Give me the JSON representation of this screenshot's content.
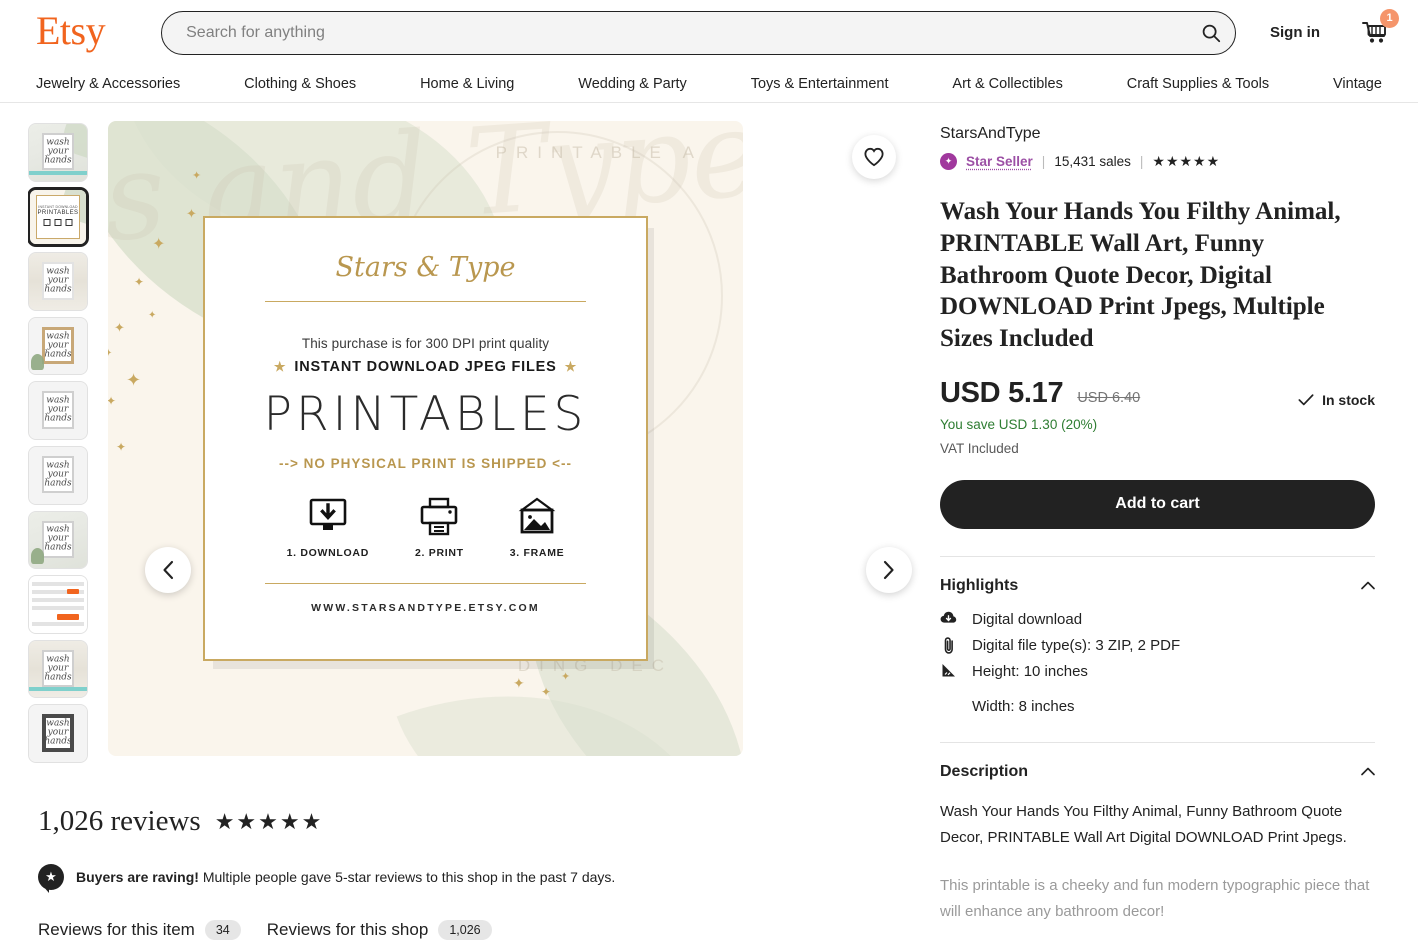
{
  "header": {
    "logo": "Etsy",
    "search_placeholder": "Search for anything",
    "search_value": "",
    "search_icon": "search-icon",
    "signin": "Sign in",
    "cart_icon": "cart-icon",
    "cart_count": "1"
  },
  "nav": {
    "items": [
      "Jewelry & Accessories",
      "Clothing & Shoes",
      "Home & Living",
      "Wedding & Party",
      "Toys & Entertainment",
      "Art & Collectibles",
      "Craft Supplies & Tools",
      "Vintage"
    ]
  },
  "gallery": {
    "favorite_icon": "heart-icon",
    "prev_label": "‹",
    "next_label": "›",
    "selected_index": 1,
    "thumbnails": [
      {
        "name": "thumb-wash-your-hands-shelf",
        "style": "wall"
      },
      {
        "name": "thumb-printables-info",
        "style": "printables"
      },
      {
        "name": "thumb-wash-your-hands-wood",
        "style": "wood"
      },
      {
        "name": "thumb-wash-your-hands-framed-wood",
        "style": "woodframe"
      },
      {
        "name": "thumb-wash-your-hands-white",
        "style": "white"
      },
      {
        "name": "thumb-wash-your-hands-plain",
        "style": "plain"
      },
      {
        "name": "thumb-wash-your-hands-plant",
        "style": "plant"
      },
      {
        "name": "thumb-how-to-download-screenshot",
        "style": "screenshot"
      },
      {
        "name": "thumb-wash-your-hands-teal",
        "style": "teal"
      },
      {
        "name": "thumb-wash-your-hands-dark-frame",
        "style": "darkframe"
      }
    ]
  },
  "hero_card": {
    "brand": "Stars & Type",
    "dpi_line": "This purchase is for 300 DPI print quality",
    "instant_line": "INSTANT DOWNLOAD JPEG FILES",
    "instant_star": "★",
    "printables": "PRINTABLES",
    "no_physical": "--> NO PHYSICAL PRINT IS SHIPPED <--",
    "steps": [
      {
        "icon": "download-monitor-icon",
        "label": "1. DOWNLOAD"
      },
      {
        "icon": "printer-icon",
        "label": "2. PRINT"
      },
      {
        "icon": "framed-picture-icon",
        "label": "3. FRAME"
      }
    ],
    "url": "WWW.STARSANDTYPE.ETSY.COM",
    "watermark": "Stars and Type",
    "watermark_arc_top": "PRINTABLE A",
    "watermark_arc_bottom": "DING DEC"
  },
  "product": {
    "shop": "StarsAndType",
    "star_seller": "Star Seller",
    "sales": "15,431 sales",
    "rating_stars": "★★★★★",
    "title": "Wash Your Hands You Filthy Animal, PRINTABLE Wall Art, Funny Bathroom Quote Decor, Digital DOWNLOAD Print Jpegs, Multiple Sizes Included",
    "price": "USD 5.17",
    "price_old": "USD 6.40",
    "you_save": "You save USD 1.30 (20%)",
    "vat": "VAT Included",
    "in_stock": "In stock",
    "in_stock_icon": "check-icon",
    "add_to_cart": "Add to cart"
  },
  "highlights": {
    "title": "Highlights",
    "collapse_icon": "chevron-up-icon",
    "items": [
      {
        "icon": "cloud-download-icon",
        "text": "Digital download"
      },
      {
        "icon": "paperclip-icon",
        "text": "Digital file type(s): 3 ZIP, 2 PDF"
      },
      {
        "icon": "ruler-icon",
        "text": "Height: 10 inches"
      }
    ],
    "sub_item": "Width: 8 inches"
  },
  "description": {
    "title": "Description",
    "collapse_icon": "chevron-up-icon",
    "paragraph1": "Wash Your Hands You Filthy Animal, Funny Bathroom Quote Decor, PRINTABLE Wall Art Digital DOWNLOAD Print Jpegs.",
    "paragraph2": "This printable is a cheeky and fun modern typographic piece that will enhance any bathroom decor!"
  },
  "reviews": {
    "count_label": "1,026 reviews",
    "stars": "★★★★★",
    "raving_bold": "Buyers are raving!",
    "raving_text": " Multiple people gave 5-star reviews to this shop in the past 7 days.",
    "raving_icon": "star-badge-icon",
    "tabs": [
      {
        "label": "Reviews for this item",
        "count": "34",
        "active": true
      },
      {
        "label": "Reviews for this shop",
        "count": "1,026",
        "active": false
      }
    ]
  },
  "colors": {
    "brand_orange": "#F1641E",
    "cart_badge": "#F5956B",
    "star_seller_purple": "#9C4FA5",
    "save_green": "#2E7D32",
    "gold": "#C9A961",
    "cream": "#FAF5EC",
    "sage": "#D9E0CE",
    "dark": "#222222"
  }
}
